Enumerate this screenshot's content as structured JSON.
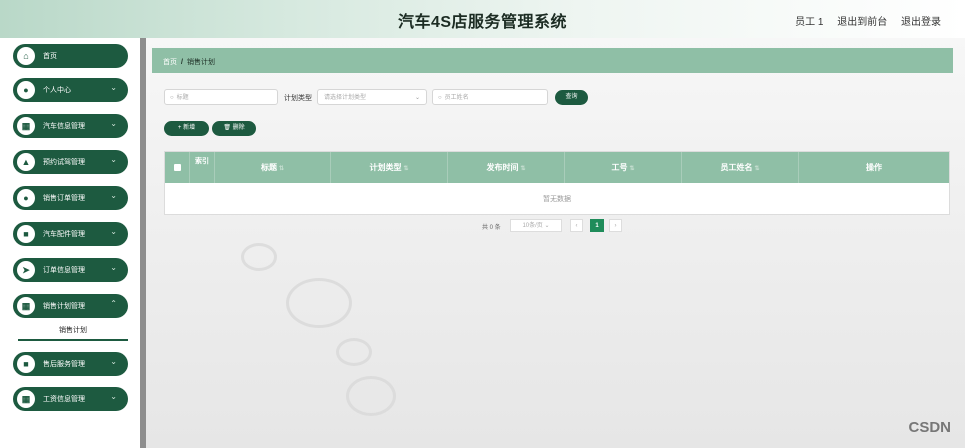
{
  "header": {
    "title": "汽车4S店服务管理系统",
    "links": [
      "员工 1",
      "退出到前台",
      "退出登录"
    ]
  },
  "sidebar": {
    "items": [
      {
        "label": "首页",
        "icon": "home-icon",
        "has_arrow": false
      },
      {
        "label": "个人中心",
        "icon": "user-icon",
        "has_arrow": true
      },
      {
        "label": "汽车信息管理",
        "icon": "grid-icon",
        "has_arrow": true
      },
      {
        "label": "预约试驾管理",
        "icon": "chart-icon",
        "has_arrow": true
      },
      {
        "label": "销售订单管理",
        "icon": "user-icon",
        "has_arrow": true
      },
      {
        "label": "汽车配件管理",
        "icon": "doc-icon",
        "has_arrow": true
      },
      {
        "label": "订单信息管理",
        "icon": "send-icon",
        "has_arrow": true
      },
      {
        "label": "销售计划管理",
        "icon": "grid-icon",
        "has_arrow": true
      },
      {
        "label": "售后服务管理",
        "icon": "doc-icon",
        "has_arrow": true
      },
      {
        "label": "工资信息管理",
        "icon": "grid-icon",
        "has_arrow": true
      }
    ],
    "submenu": {
      "label": "销售计划"
    }
  },
  "breadcrumb": {
    "home": "首页",
    "separator": "/",
    "current": "销售计划"
  },
  "search": {
    "title_placeholder": "标题",
    "plan_type_label": "计划类型",
    "plan_type_placeholder": "请选择计划类型",
    "staff_name_placeholder": "员工姓名",
    "query_button": "查询"
  },
  "actions": {
    "add": "+ 新增",
    "delete": "删除"
  },
  "table": {
    "columns": [
      "索引",
      "标题",
      "计划类型",
      "发布时间",
      "工号",
      "员工姓名",
      "操作"
    ],
    "empty_text": "暂无数据"
  },
  "pagination": {
    "total": "共 0 条",
    "page_size": "10条/页",
    "current_page": "1"
  },
  "watermark": "CSDN"
}
